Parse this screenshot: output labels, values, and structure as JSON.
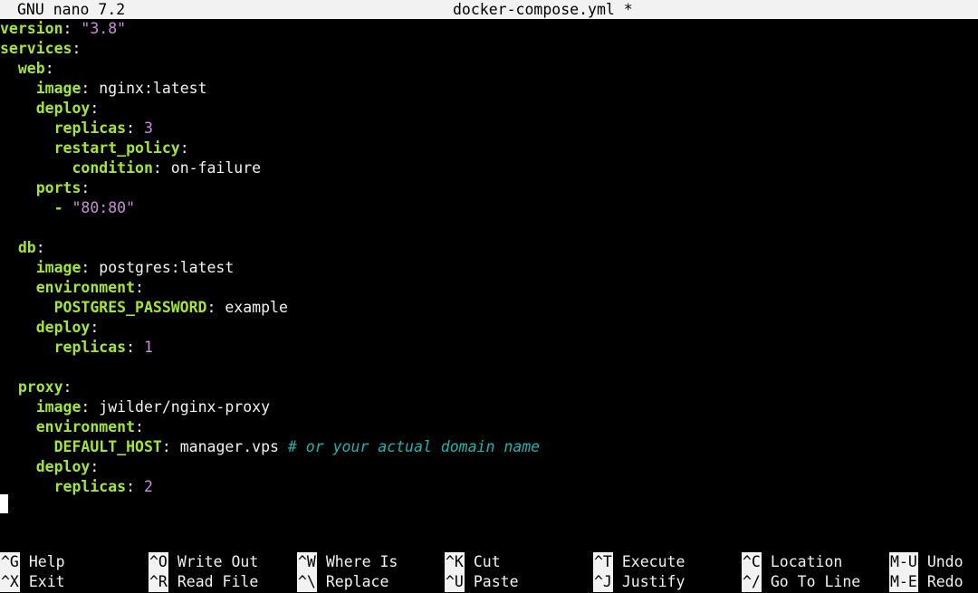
{
  "titlebar": {
    "app_name": "GNU nano 7.2",
    "file_name": "docker-compose.yml *"
  },
  "editor": {
    "lines": [
      {
        "indent": "",
        "key": "version",
        "sep": ": ",
        "value": "\"3.8\"",
        "value_type": "string"
      },
      {
        "indent": "",
        "key": "services",
        "sep": ":",
        "value": "",
        "value_type": ""
      },
      {
        "indent": "  ",
        "key": "web",
        "sep": ":",
        "value": "",
        "value_type": ""
      },
      {
        "indent": "    ",
        "key": "image",
        "sep": ": ",
        "value": "nginx:latest",
        "value_type": "plain"
      },
      {
        "indent": "    ",
        "key": "deploy",
        "sep": ":",
        "value": "",
        "value_type": ""
      },
      {
        "indent": "      ",
        "key": "replicas",
        "sep": ": ",
        "value": "3",
        "value_type": "number"
      },
      {
        "indent": "      ",
        "key": "restart_policy",
        "sep": ":",
        "value": "",
        "value_type": ""
      },
      {
        "indent": "        ",
        "key": "condition",
        "sep": ": ",
        "value": "on-failure",
        "value_type": "plain"
      },
      {
        "indent": "    ",
        "key": "ports",
        "sep": ":",
        "value": "",
        "value_type": ""
      },
      {
        "indent": "      ",
        "key": "-",
        "sep": " ",
        "value": "\"80:80\"",
        "value_type": "string"
      },
      {
        "indent": "",
        "key": "",
        "sep": "",
        "value": "",
        "value_type": ""
      },
      {
        "indent": "  ",
        "key": "db",
        "sep": ":",
        "value": "",
        "value_type": ""
      },
      {
        "indent": "    ",
        "key": "image",
        "sep": ": ",
        "value": "postgres:latest",
        "value_type": "plain"
      },
      {
        "indent": "    ",
        "key": "environment",
        "sep": ":",
        "value": "",
        "value_type": ""
      },
      {
        "indent": "      ",
        "key": "POSTGRES_PASSWORD",
        "sep": ": ",
        "value": "example",
        "value_type": "plain"
      },
      {
        "indent": "    ",
        "key": "deploy",
        "sep": ":",
        "value": "",
        "value_type": ""
      },
      {
        "indent": "      ",
        "key": "replicas",
        "sep": ": ",
        "value": "1",
        "value_type": "number"
      },
      {
        "indent": "",
        "key": "",
        "sep": "",
        "value": "",
        "value_type": ""
      },
      {
        "indent": "  ",
        "key": "proxy",
        "sep": ":",
        "value": "",
        "value_type": ""
      },
      {
        "indent": "    ",
        "key": "image",
        "sep": ": ",
        "value": "jwilder/nginx-proxy",
        "value_type": "plain"
      },
      {
        "indent": "    ",
        "key": "environment",
        "sep": ":",
        "value": "",
        "value_type": ""
      },
      {
        "indent": "      ",
        "key": "DEFAULT_HOST",
        "sep": ": ",
        "value": "manager.vps",
        "value_type": "plain",
        "comment": " # or your actual domain name"
      },
      {
        "indent": "    ",
        "key": "deploy",
        "sep": ":",
        "value": "",
        "value_type": ""
      },
      {
        "indent": "      ",
        "key": "replicas",
        "sep": ": ",
        "value": "2",
        "value_type": "number"
      }
    ]
  },
  "shortcuts": [
    {
      "key": "^G",
      "label": "Help"
    },
    {
      "key": "^X",
      "label": "Exit"
    },
    {
      "key": "^O",
      "label": "Write Out"
    },
    {
      "key": "^R",
      "label": "Read File"
    },
    {
      "key": "^W",
      "label": "Where Is"
    },
    {
      "key": "^\\",
      "label": "Replace"
    },
    {
      "key": "^K",
      "label": "Cut"
    },
    {
      "key": "^U",
      "label": "Paste"
    },
    {
      "key": "^T",
      "label": "Execute"
    },
    {
      "key": "^J",
      "label": "Justify"
    },
    {
      "key": "^C",
      "label": "Location"
    },
    {
      "key": "^/",
      "label": "Go To Line"
    },
    {
      "key": "M-U",
      "label": "Undo"
    },
    {
      "key": "M-E",
      "label": "Redo"
    }
  ],
  "colors": {
    "key": "#a4e53a",
    "string": "#c98ed6",
    "number": "#c98ed6",
    "comment": "#1fb3b0",
    "background": "#000000",
    "titlebar": "#f2f2f2"
  }
}
